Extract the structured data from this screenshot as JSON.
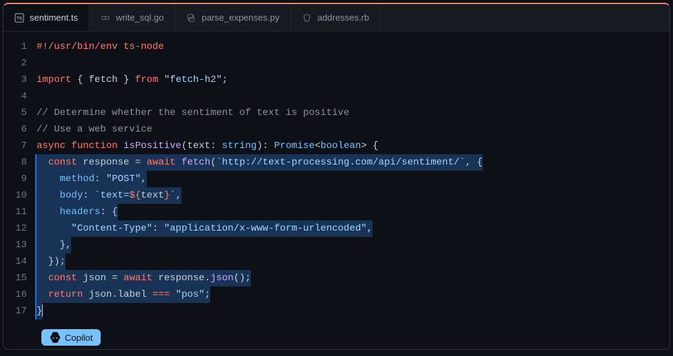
{
  "tabs": [
    {
      "label": "sentiment.ts",
      "icon": "ts",
      "active": true
    },
    {
      "label": "write_sql.go",
      "icon": "go",
      "active": false
    },
    {
      "label": "parse_expenses.py",
      "icon": "py",
      "active": false
    },
    {
      "label": "addresses.rb",
      "icon": "rb",
      "active": false
    }
  ],
  "gutter": [
    "1",
    "2",
    "3",
    "4",
    "5",
    "6",
    "7",
    "8",
    "9",
    "10",
    "11",
    "12",
    "13",
    "14",
    "15",
    "16",
    "17"
  ],
  "code": {
    "l1": {
      "shebang": "#!/usr/bin/env ts-node"
    },
    "l3": {
      "kw_import": "import",
      "braces": " { ",
      "id": "fetch",
      "braces2": " } ",
      "kw_from": "from",
      "sp": " ",
      "str": "\"fetch-h2\"",
      "semi": ";"
    },
    "l5": {
      "comment": "// Determine whether the sentiment of text is positive"
    },
    "l6": {
      "comment": "// Use a web service"
    },
    "l7": {
      "kw_async": "async",
      "sp1": " ",
      "kw_function": "function",
      "sp2": " ",
      "fn": "isPositive",
      "open": "(",
      "param": "text",
      "colon": ": ",
      "type1": "string",
      "close": ")",
      "colon2": ": ",
      "type2": "Promise",
      "lt": "<",
      "type3": "boolean",
      "gt": ">",
      "brace": " {"
    },
    "l8": {
      "indent": "  ",
      "kw_const": "const",
      "sp1": " ",
      "id": "response",
      "sp2": " ",
      "eq": "=",
      "sp3": " ",
      "kw_await": "await",
      "sp4": " ",
      "fn": "fetch",
      "open": "(",
      "btick1": "`",
      "url": "http://text-processing.com/api/sentiment/",
      "btick2": "`",
      "comma": ", ",
      "brace": "{"
    },
    "l9": {
      "indent": "    ",
      "key": "method",
      "colon": ": ",
      "val": "\"POST\"",
      "comma": ","
    },
    "l10": {
      "indent": "    ",
      "key": "body",
      "colon": ": ",
      "btick1": "`",
      "tmpl1": "text=",
      "interp_open": "${",
      "var": "text",
      "interp_close": "}",
      "btick2": "`",
      "comma": ","
    },
    "l11": {
      "indent": "    ",
      "key": "headers",
      "colon": ": ",
      "brace": "{"
    },
    "l12": {
      "indent": "      ",
      "key": "\"Content-Type\"",
      "colon": ": ",
      "val": "\"application/x-www-form-urlencoded\"",
      "comma": ","
    },
    "l13": {
      "indent": "    ",
      "brace": "}",
      "comma": ","
    },
    "l14": {
      "indent": "  ",
      "brace": "}",
      "paren": ")",
      "semi": ";"
    },
    "l15": {
      "indent": "  ",
      "kw_const": "const",
      "sp1": " ",
      "id": "json",
      "sp2": " ",
      "eq": "=",
      "sp3": " ",
      "kw_await": "await",
      "sp4": " ",
      "obj": "response",
      "dot": ".",
      "fn": "json",
      "call": "()",
      "semi": ";"
    },
    "l16": {
      "indent": "  ",
      "kw_return": "return",
      "sp1": " ",
      "obj": "json",
      "dot": ".",
      "prop": "label",
      "sp2": " ",
      "op": "===",
      "sp3": " ",
      "str": "\"pos\"",
      "semi": ";"
    },
    "l17": {
      "brace": "}"
    }
  },
  "copilot": {
    "label": "Copilot"
  }
}
